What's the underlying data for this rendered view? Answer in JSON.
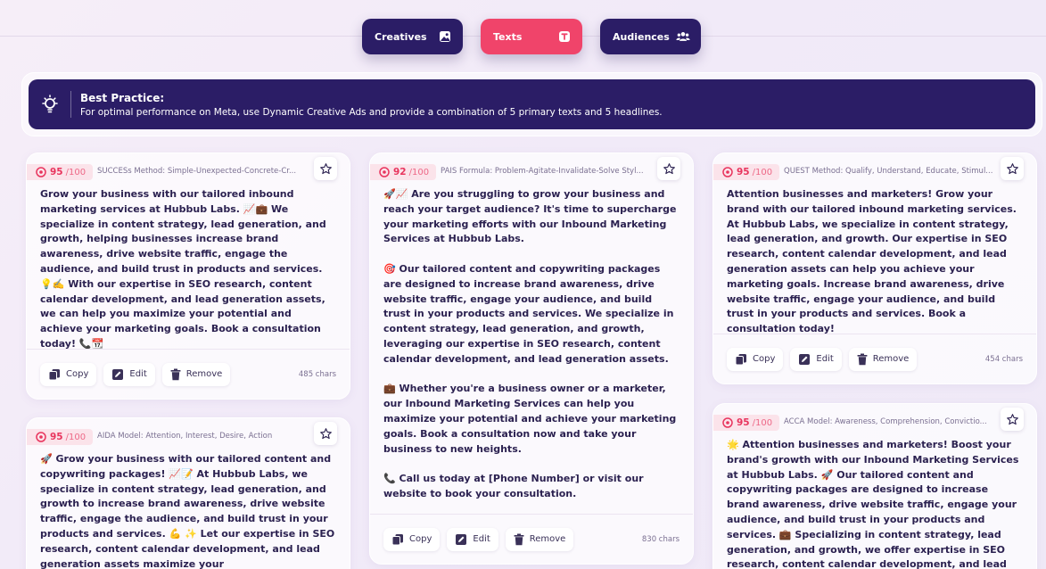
{
  "tabs": [
    {
      "label": "Creatives",
      "icon": "image-icon"
    },
    {
      "label": "Texts",
      "icon": "text-icon"
    },
    {
      "label": "Audiences",
      "icon": "users-icon"
    }
  ],
  "banner": {
    "title": "Best Practice:",
    "description": "For optimal performance on Meta, use Dynamic Creative Ads and provide a combination of 5 primary texts and 5 headlines."
  },
  "actions": {
    "copy": "Copy",
    "edit": "Edit",
    "remove": "Remove"
  },
  "colors": {
    "primary": "#2b1d66",
    "accent": "#f0446a",
    "score": "#e8345d"
  },
  "cards": [
    {
      "score": "95",
      "score_max": "/100",
      "method": "SUCCESs Method: Simple-Unexpected-Concrete-Cr...",
      "paragraphs": [
        "Grow your business with our tailored inbound marketing services at Hubbub Labs. 📈💼 We specialize in content strategy, lead generation, and growth, helping businesses increase brand awareness, drive website traffic, engage the audience, and build trust in products and services. 💡✍️ With our expertise in SEO research, content calendar development, and lead generation assets, we can help you maximize your potential and achieve your marketing goals. Book a consultation today! 📞📆"
      ],
      "chars": "485 chars"
    },
    {
      "score": "95",
      "score_max": "/100",
      "method": "AIDA Model: Attention, Interest, Desire, Action",
      "paragraphs": [
        "🚀 Grow your business with our tailored content and copywriting packages! 📈📝 At Hubbub Labs, we specialize in content strategy, lead generation, and growth to increase brand awareness, drive website traffic, engage the audience, and build trust in your products and services. 💪 ✨ Let our expertise in SEO research, content calendar development, and lead generation assets maximize your"
      ],
      "chars": ""
    },
    {
      "score": "92",
      "score_max": "/100",
      "method": "PAIS Formula: Problem-Agitate-Invalidate-Solve Styl...",
      "paragraphs": [
        "🚀📈 Are you struggling to grow your business and reach your target audience? It's time to supercharge your marketing efforts with our Inbound Marketing Services at Hubbub Labs.",
        "🎯 Our tailored content and copywriting packages are designed to increase brand awareness, drive website traffic, engage your audience, and build trust in your products and services. We specialize in content strategy, lead generation, and growth, leveraging our expertise in SEO research, content calendar development, and lead generation assets.",
        "💼 Whether you're a business owner or a marketer, our Inbound Marketing Services can help you maximize your potential and achieve your marketing goals. Book a consultation now and take your business to new heights.",
        "📞 Call us today at [Phone Number] or visit our website to book your consultation."
      ],
      "chars": "830 chars"
    },
    {
      "score": "95",
      "score_max": "/100",
      "method": "QUEST Method: Qualify, Understand, Educate, Stimul...",
      "paragraphs": [
        "Attention businesses and marketers! Grow your brand with our tailored inbound marketing services. At Hubbub Labs, we specialize in content strategy, lead generation, and growth. Our expertise in SEO research, content calendar development, and lead generation assets can help you achieve your marketing goals. Increase brand awareness, drive website traffic, engage your audience, and build trust in your products and services. Book a consultation today!"
      ],
      "chars": "454 chars"
    },
    {
      "score": "95",
      "score_max": "/100",
      "method": "ACCA Model: Awareness, Comprehension, Convictio...",
      "paragraphs": [
        "🌟 Attention businesses and marketers! Boost your brand's growth with our Inbound Marketing Services at Hubbub Labs. 🚀 Our tailored content and copywriting packages are designed to increase brand awareness, drive website traffic, engage your audience, and build trust in your products and services. 💼 Specializing in content strategy, lead generation, and growth, we offer expertise in SEO research, content calendar development, and lead"
      ],
      "chars": ""
    }
  ]
}
